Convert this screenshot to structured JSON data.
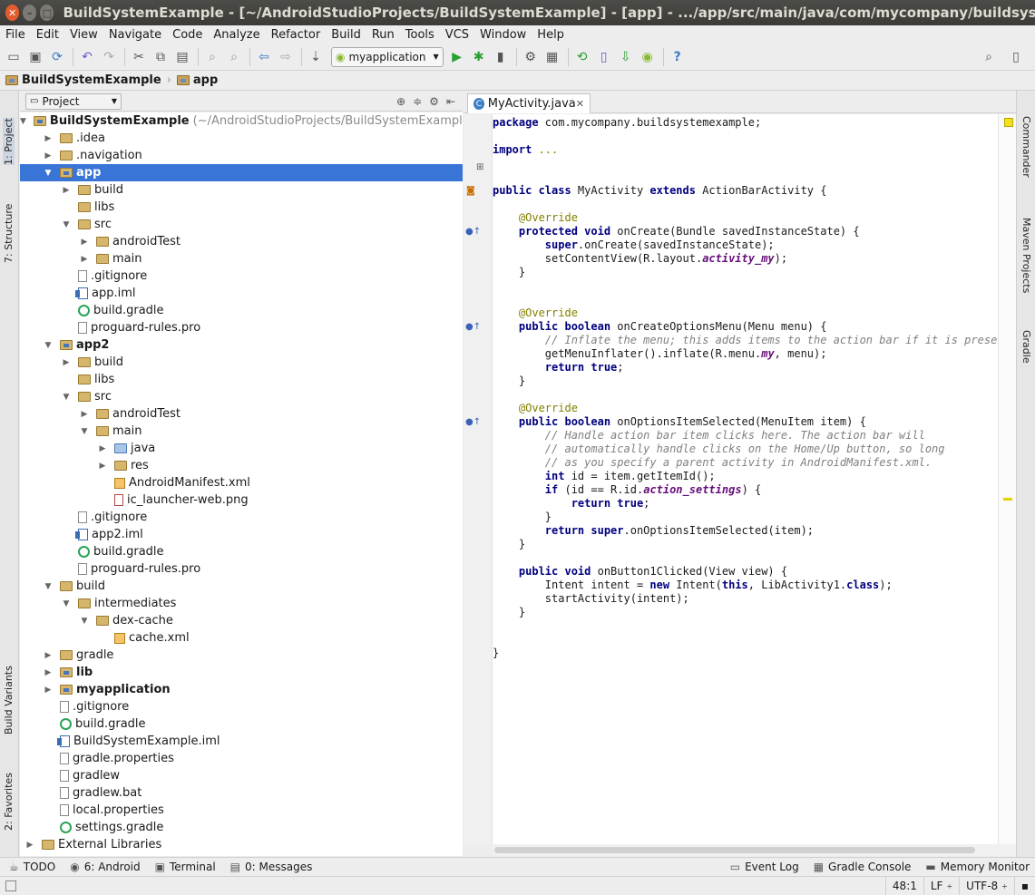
{
  "window": {
    "title": "BuildSystemExample - [~/AndroidStudioProjects/BuildSystemExample] - [app] - .../app/src/main/java/com/mycompany/buildsystemexample/MyActivity"
  },
  "menu": [
    "File",
    "Edit",
    "View",
    "Navigate",
    "Code",
    "Analyze",
    "Refactor",
    "Build",
    "Run",
    "Tools",
    "VCS",
    "Window",
    "Help"
  ],
  "toolbar": {
    "run_config": "myapplication"
  },
  "breadcrumb": [
    "BuildSystemExample",
    "app"
  ],
  "left_tabs": {
    "project": "1: Project",
    "structure": "7: Structure",
    "build_variants": "Build Variants",
    "favorites": "2: Favorites"
  },
  "right_tabs": {
    "commander": "Commander",
    "maven": "Maven Projects",
    "gradle": "Gradle"
  },
  "project_panel": {
    "view_selector": "Project"
  },
  "tree": [
    {
      "label": "BuildSystemExample",
      "extra": "(~/AndroidStudioProjects/BuildSystemExample)",
      "indent": 0,
      "icon": "module",
      "expand": "open",
      "bold": true
    },
    {
      "label": ".idea",
      "indent": 1,
      "icon": "folder",
      "expand": "closed"
    },
    {
      "label": ".navigation",
      "indent": 1,
      "icon": "folder",
      "expand": "closed"
    },
    {
      "label": "app",
      "indent": 1,
      "icon": "module",
      "expand": "open",
      "bold": true,
      "selected": true
    },
    {
      "label": "build",
      "indent": 2,
      "icon": "folder",
      "expand": "closed"
    },
    {
      "label": "libs",
      "indent": 2,
      "icon": "folder",
      "expand": "none"
    },
    {
      "label": "src",
      "indent": 2,
      "icon": "folder",
      "expand": "open"
    },
    {
      "label": "androidTest",
      "indent": 3,
      "icon": "folder",
      "expand": "closed"
    },
    {
      "label": "main",
      "indent": 3,
      "icon": "folder",
      "expand": "closed"
    },
    {
      "label": ".gitignore",
      "indent": 2,
      "icon": "file",
      "expand": "none"
    },
    {
      "label": "app.iml",
      "indent": 2,
      "icon": "iml",
      "expand": "none"
    },
    {
      "label": "build.gradle",
      "indent": 2,
      "icon": "gradle",
      "expand": "none"
    },
    {
      "label": "proguard-rules.pro",
      "indent": 2,
      "icon": "file",
      "expand": "none"
    },
    {
      "label": "app2",
      "indent": 1,
      "icon": "module",
      "expand": "open",
      "bold": true
    },
    {
      "label": "build",
      "indent": 2,
      "icon": "folder",
      "expand": "closed"
    },
    {
      "label": "libs",
      "indent": 2,
      "icon": "folder",
      "expand": "none"
    },
    {
      "label": "src",
      "indent": 2,
      "icon": "folder",
      "expand": "open"
    },
    {
      "label": "androidTest",
      "indent": 3,
      "icon": "folder",
      "expand": "closed"
    },
    {
      "label": "main",
      "indent": 3,
      "icon": "folder",
      "expand": "open"
    },
    {
      "label": "java",
      "indent": 4,
      "icon": "bluefolder",
      "expand": "closed"
    },
    {
      "label": "res",
      "indent": 4,
      "icon": "folder",
      "expand": "closed"
    },
    {
      "label": "AndroidManifest.xml",
      "indent": 4,
      "icon": "xml",
      "expand": "none"
    },
    {
      "label": "ic_launcher-web.png",
      "indent": 4,
      "icon": "png",
      "expand": "none"
    },
    {
      "label": ".gitignore",
      "indent": 2,
      "icon": "file",
      "expand": "none"
    },
    {
      "label": "app2.iml",
      "indent": 2,
      "icon": "iml",
      "expand": "none"
    },
    {
      "label": "build.gradle",
      "indent": 2,
      "icon": "gradle",
      "expand": "none"
    },
    {
      "label": "proguard-rules.pro",
      "indent": 2,
      "icon": "file",
      "expand": "none"
    },
    {
      "label": "build",
      "indent": 1,
      "icon": "folder",
      "expand": "open"
    },
    {
      "label": "intermediates",
      "indent": 2,
      "icon": "folder",
      "expand": "open"
    },
    {
      "label": "dex-cache",
      "indent": 3,
      "icon": "folder",
      "expand": "open"
    },
    {
      "label": "cache.xml",
      "indent": 4,
      "icon": "xml",
      "expand": "none"
    },
    {
      "label": "gradle",
      "indent": 1,
      "icon": "folder",
      "expand": "closed"
    },
    {
      "label": "lib",
      "indent": 1,
      "icon": "module",
      "expand": "closed",
      "bold": true
    },
    {
      "label": "myapplication",
      "indent": 1,
      "icon": "module",
      "expand": "closed",
      "bold": true
    },
    {
      "label": ".gitignore",
      "indent": 1,
      "icon": "file",
      "expand": "none"
    },
    {
      "label": "build.gradle",
      "indent": 1,
      "icon": "gradle",
      "expand": "none"
    },
    {
      "label": "BuildSystemExample.iml",
      "indent": 1,
      "icon": "iml",
      "expand": "none"
    },
    {
      "label": "gradle.properties",
      "indent": 1,
      "icon": "file",
      "expand": "none"
    },
    {
      "label": "gradlew",
      "indent": 1,
      "icon": "file",
      "expand": "none"
    },
    {
      "label": "gradlew.bat",
      "indent": 1,
      "icon": "file",
      "expand": "none"
    },
    {
      "label": "local.properties",
      "indent": 1,
      "icon": "file",
      "expand": "none"
    },
    {
      "label": "settings.gradle",
      "indent": 1,
      "icon": "gradle",
      "expand": "none"
    },
    {
      "label": "External Libraries",
      "indent": 0,
      "icon": "folder",
      "expand": "closed"
    }
  ],
  "editor": {
    "tab": "MyActivity.java",
    "code": [
      [
        [
          "package ",
          "kw"
        ],
        [
          "com.mycompany.buildsystemexample;",
          ""
        ]
      ],
      [],
      [
        [
          "import ",
          "kw"
        ],
        [
          "...",
          "an"
        ]
      ],
      [],
      [],
      [
        [
          "public class ",
          "kw"
        ],
        [
          "MyActivity ",
          ""
        ],
        [
          "extends ",
          "kw"
        ],
        [
          "ActionBarActivity {",
          ""
        ]
      ],
      [],
      [
        [
          "    @Override",
          "an"
        ]
      ],
      [
        [
          "    protected void ",
          "kw"
        ],
        [
          "onCreate(Bundle savedInstanceState) {",
          ""
        ]
      ],
      [
        [
          "        super",
          "kw"
        ],
        [
          ".onCreate(savedInstanceState);",
          ""
        ]
      ],
      [
        [
          "        setContentView(R.layout.",
          ""
        ],
        [
          "activity_my",
          "fl"
        ],
        [
          ");",
          ""
        ]
      ],
      [
        [
          "    }",
          ""
        ]
      ],
      [],
      [],
      [
        [
          "    @Override",
          "an"
        ]
      ],
      [
        [
          "    public boolean ",
          "kw"
        ],
        [
          "onCreateOptionsMenu(Menu menu) {",
          ""
        ]
      ],
      [
        [
          "        // Inflate the menu; this adds items to the action bar if it is present.",
          "cm"
        ]
      ],
      [
        [
          "        getMenuInflater().inflate(R.menu.",
          ""
        ],
        [
          "my",
          "fl"
        ],
        [
          ", menu);",
          ""
        ]
      ],
      [
        [
          "        return true",
          "kw"
        ],
        [
          ";",
          ""
        ]
      ],
      [
        [
          "    }",
          ""
        ]
      ],
      [],
      [
        [
          "    @Override",
          "an"
        ]
      ],
      [
        [
          "    public boolean ",
          "kw"
        ],
        [
          "onOptionsItemSelected(MenuItem item) {",
          ""
        ]
      ],
      [
        [
          "        // Handle action bar item clicks here. The action bar will",
          "cm"
        ]
      ],
      [
        [
          "        // automatically handle clicks on the Home/Up button, so long",
          "cm"
        ]
      ],
      [
        [
          "        // as you specify a parent activity in AndroidManifest.xml.",
          "cm"
        ]
      ],
      [
        [
          "        int ",
          "kw"
        ],
        [
          "id = item.getItemId();",
          ""
        ]
      ],
      [
        [
          "        if ",
          "kw"
        ],
        [
          "(id == R.id.",
          ""
        ],
        [
          "action_settings",
          "fl"
        ],
        [
          ") {",
          ""
        ]
      ],
      [
        [
          "            return true",
          "kw"
        ],
        [
          ";",
          ""
        ]
      ],
      [
        [
          "        }",
          ""
        ]
      ],
      [
        [
          "        return super",
          "kw"
        ],
        [
          ".onOptionsItemSelected(item);",
          ""
        ]
      ],
      [
        [
          "    }",
          ""
        ]
      ],
      [],
      [
        [
          "    public void ",
          "kw"
        ],
        [
          "onButton1Clicked(View view) {",
          ""
        ]
      ],
      [
        [
          "        Intent intent = ",
          ""
        ],
        [
          "new ",
          "kw"
        ],
        [
          "Intent(",
          ""
        ],
        [
          "this",
          "kw"
        ],
        [
          ", LibActivity1.",
          ""
        ],
        [
          "class",
          "kw"
        ],
        [
          ");",
          ""
        ]
      ],
      [
        [
          "        startActivity(intent);",
          ""
        ]
      ],
      [
        [
          "    }",
          ""
        ]
      ],
      [],
      [],
      [
        [
          "}",
          ""
        ]
      ],
      []
    ],
    "cursor_line": 41
  },
  "bottom_tools": [
    {
      "icon": "todo-icon",
      "label": "TODO"
    },
    {
      "icon": "android-icon",
      "label": "6: Android"
    },
    {
      "icon": "terminal-icon",
      "label": "Terminal"
    },
    {
      "icon": "messages-icon",
      "label": "0: Messages"
    }
  ],
  "bottom_right_tools": [
    {
      "icon": "event-log-icon",
      "label": "Event Log"
    },
    {
      "icon": "gradle-console-icon",
      "label": "Gradle Console"
    },
    {
      "icon": "memory-monitor-icon",
      "label": "Memory Monitor"
    }
  ],
  "status": {
    "position": "48:1",
    "line_sep": "LF",
    "encoding": "UTF-8"
  }
}
